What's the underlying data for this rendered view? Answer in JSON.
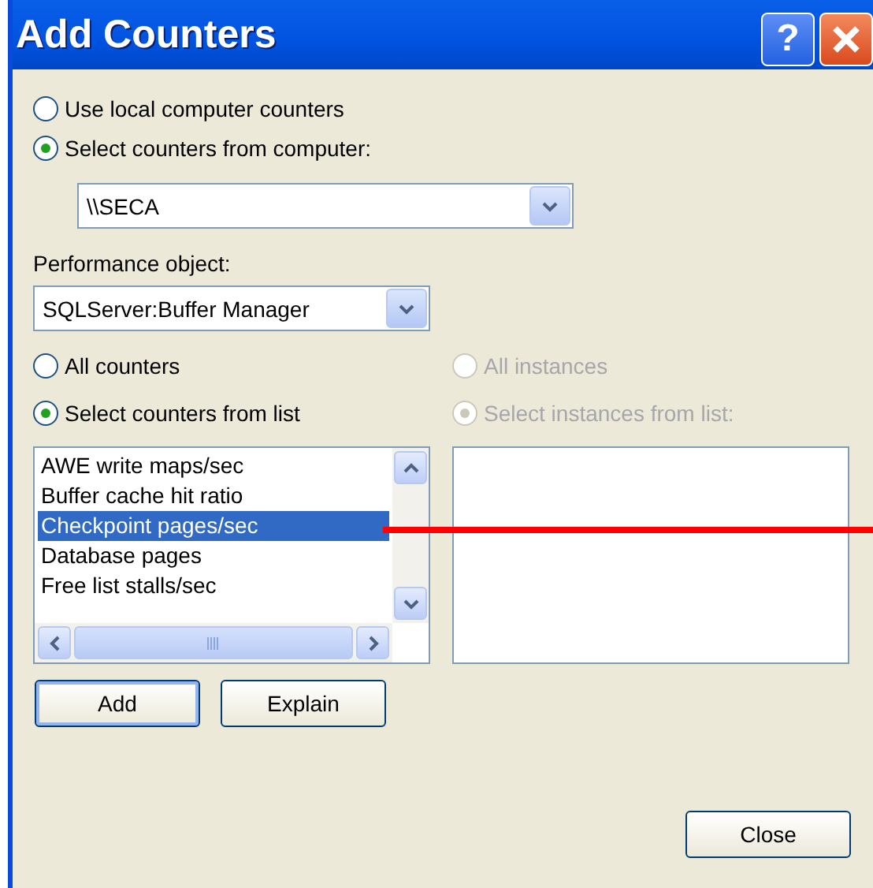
{
  "window": {
    "title": "Add Counters",
    "title_buttons": [
      {
        "kind": "help",
        "label": "?"
      },
      {
        "kind": "close"
      }
    ]
  },
  "computer_source": [
    {
      "label": "Use local computer counters",
      "selected": false
    },
    {
      "label": "Select counters from computer:",
      "selected": true
    }
  ],
  "computer": {
    "value": "\\\\SECA"
  },
  "performance_object": {
    "label": "Performance object:",
    "value": "SQLServer:Buffer Manager"
  },
  "counter_mode": [
    {
      "label": "All counters",
      "selected": false
    },
    {
      "label": "Select counters from list",
      "selected": true
    }
  ],
  "instance_mode": [
    {
      "label": "All instances",
      "selected": false,
      "disabled": true
    },
    {
      "label": "Select instances from list:",
      "selected": true,
      "disabled": true
    }
  ],
  "counters": [
    {
      "label": "AWE write maps/sec",
      "selected": false
    },
    {
      "label": "Buffer cache hit ratio",
      "selected": false
    },
    {
      "label": "Checkpoint pages/sec",
      "selected": true
    },
    {
      "label": "Database pages",
      "selected": false
    },
    {
      "label": "Free list stalls/sec",
      "selected": false
    }
  ],
  "buttons": [
    {
      "label": "Add",
      "default": true
    },
    {
      "label": "Explain",
      "default": false
    }
  ],
  "close_button": "Close",
  "annotation": {
    "kind": "pointer-line"
  }
}
